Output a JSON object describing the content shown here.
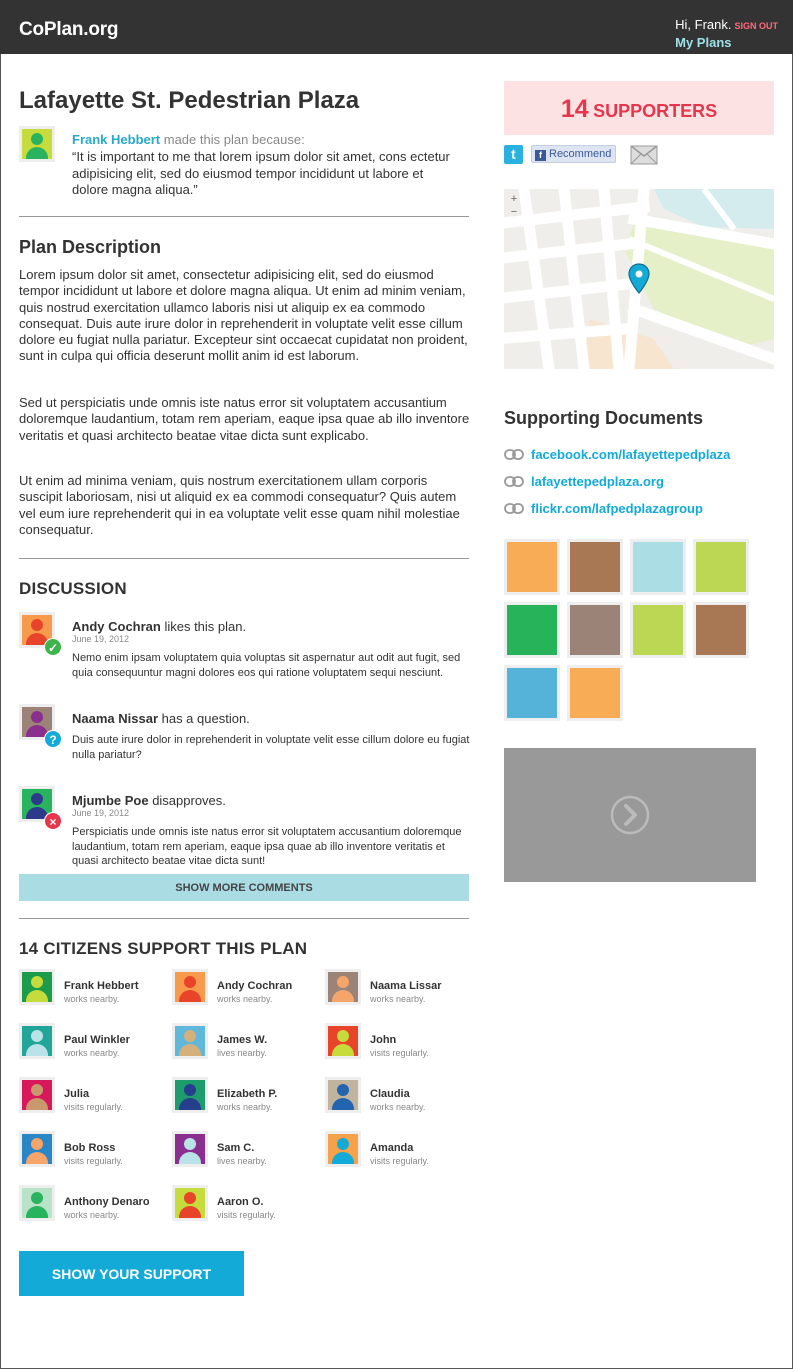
{
  "header": {
    "logo": "CoPlan.org",
    "greeting": "Hi, Frank.",
    "sign_out": "SIGN OUT",
    "my_plans": "My Plans"
  },
  "plan": {
    "title": "Lafayette St. Pedestrian Plaza",
    "author": "Frank Hebbert",
    "author_suffix": " made this plan because:",
    "quote": "“It is important to me that lorem ipsum dolor sit amet, cons ectetur adipisicing elit, sed do eiusmod tempor incididunt ut labore et dolore magna aliqua.”",
    "description_heading": "Plan Description",
    "description": [
      "Lorem ipsum dolor sit amet, consectetur adipisicing elit, sed do eiusmod tempor incididunt ut labore et dolore magna aliqua. Ut enim ad minim veniam, quis nostrud exercitation ullamco laboris nisi ut aliquip ex ea commodo consequat. Duis aute irure dolor in reprehenderit in voluptate velit esse cillum dolore eu fugiat nulla pariatur. Excepteur sint occaecat cupidatat non proident, sunt in culpa qui officia deserunt mollit anim id est laborum.",
      "Sed ut perspiciatis unde omnis iste natus error sit voluptatem accusantium doloremque laudantium, totam rem aperiam, eaque ipsa quae ab illo inventore veritatis et quasi architecto beatae vitae dicta sunt explicabo.",
      "Ut enim ad minima veniam, quis nostrum exercitationem ullam corporis suscipit laboriosam, nisi ut aliquid ex ea commodi consequatur? Quis autem vel eum iure reprehenderit qui in ea voluptate velit esse quam nihil molestiae consequatur."
    ]
  },
  "discussion": {
    "heading": "DISCUSSION",
    "comments": [
      {
        "name": "Andy Cochran",
        "action": " likes this plan.",
        "date": "June 19, 2012",
        "text": "Nemo enim ipsam voluptatem quia voluptas sit aspernatur aut odit aut fugit, sed quia consequuntur magni dolores eos qui ratione voluptatem sequi nesciunt.",
        "badge": "check",
        "badge_color": "#3cb54a",
        "avatar_bg": "#f89a4b",
        "avatar_head": "#e8442a",
        "avatar_body": "#e8442a"
      },
      {
        "name": "Naama Nissar",
        "action": " has a question.",
        "date": "",
        "text": "Duis aute irure dolor in reprehenderit in voluptate velit esse cillum dolore eu fugiat nulla pariatur?",
        "badge": "?",
        "badge_color": "#14aad7",
        "avatar_bg": "#9b8378",
        "avatar_head": "#8b2f8f",
        "avatar_body": "#8b2f8f"
      },
      {
        "name": "Mjumbe Poe",
        "action": " disapproves.",
        "date": "June 19, 2012",
        "text": "Perspiciatis unde omnis iste natus error sit voluptatem accusantium doloremque laudantium, totam rem aperiam, eaque ipsa quae ab illo inventore veritatis et quasi architecto beatae vitae dicta sunt!",
        "badge": "×",
        "badge_color": "#e5364c",
        "avatar_bg": "#2ab35f",
        "avatar_head": "#2d3a8c",
        "avatar_body": "#2d3a8c"
      }
    ],
    "show_more": "SHOW MORE COMMENTS"
  },
  "support": {
    "heading": "14 CITIZENS SUPPORT THIS PLAN",
    "cta": "SHOW YOUR SUPPORT",
    "supporters": [
      {
        "name": "Frank Hebbert",
        "note": "works nearby.",
        "bg": "#1c9c4a",
        "head": "#c5dc3c",
        "body": "#c5dc3c"
      },
      {
        "name": "Andy Cochran",
        "note": "works nearby.",
        "bg": "#f89a4b",
        "head": "#e8442a",
        "body": "#e8442a"
      },
      {
        "name": "Naama Lissar",
        "note": "works nearby.",
        "bg": "#9b8378",
        "head": "#f5a46a",
        "body": "#f5a46a"
      },
      {
        "name": "Paul Winkler",
        "note": "works nearby.",
        "bg": "#22a599",
        "head": "#b9e3e8",
        "body": "#b9e3e8"
      },
      {
        "name": "James W.",
        "note": "lives nearby.",
        "bg": "#5fb7d9",
        "head": "#d6b07a",
        "body": "#d6b07a"
      },
      {
        "name": "John",
        "note": "visits regularly.",
        "bg": "#e8442a",
        "head": "#c5dc3c",
        "body": "#c5dc3c"
      },
      {
        "name": "Julia",
        "note": "visits regularly.",
        "bg": "#d7195b",
        "head": "#c9986e",
        "body": "#c9986e"
      },
      {
        "name": "Elizabeth P.",
        "note": "works nearby.",
        "bg": "#1e9c6e",
        "head": "#253f8c",
        "body": "#253f8c"
      },
      {
        "name": "Claudia",
        "note": "works nearby.",
        "bg": "#c0b49f",
        "head": "#2264b0",
        "body": "#2264b0"
      },
      {
        "name": "Bob Ross",
        "note": "visits regularly.",
        "bg": "#2b86c6",
        "head": "#f5a46a",
        "body": "#f5a46a"
      },
      {
        "name": "Sam C.",
        "note": "lives nearby.",
        "bg": "#8b2f8f",
        "head": "#b9e3e8",
        "body": "#b9e3e8"
      },
      {
        "name": "Amanda",
        "note": "visits regularly.",
        "bg": "#f8a14b",
        "head": "#14aad7",
        "body": "#14aad7"
      },
      {
        "name": "Anthony Denaro",
        "note": "works nearby.",
        "bg": "#b9e3c8",
        "head": "#2ab35f",
        "body": "#2ab35f"
      },
      {
        "name": "Aaron O.",
        "note": "visits regularly.",
        "bg": "#c5dc3c",
        "head": "#e8442a",
        "body": "#e8442a"
      }
    ]
  },
  "sidebar": {
    "supporters_count": "14",
    "supporters_label": "SUPPORTERS",
    "share": {
      "recommend": "Recommend",
      "twitter_icon": "t"
    },
    "docs_heading": "Supporting Documents",
    "docs": [
      "facebook.com/lafayettepedplaza",
      "lafayettepedplaza.org",
      "flickr.com/lafpedplazagroup"
    ],
    "photos": [
      "#f8ac56",
      "#a87753",
      "#aadde4",
      "#bcd753",
      "#27b35a",
      "#9b8378",
      "#bcd753",
      "#a87753",
      "#55b3da",
      "#f8ac56"
    ],
    "map_zoom_in": "+",
    "map_zoom_out": "−"
  },
  "colors": {
    "accent": "#14aad7",
    "header_bg": "#333333",
    "supporters_bg": "#fde2e4",
    "supporters_text": "#e5364c",
    "show_more_bg": "#a9dde3"
  }
}
